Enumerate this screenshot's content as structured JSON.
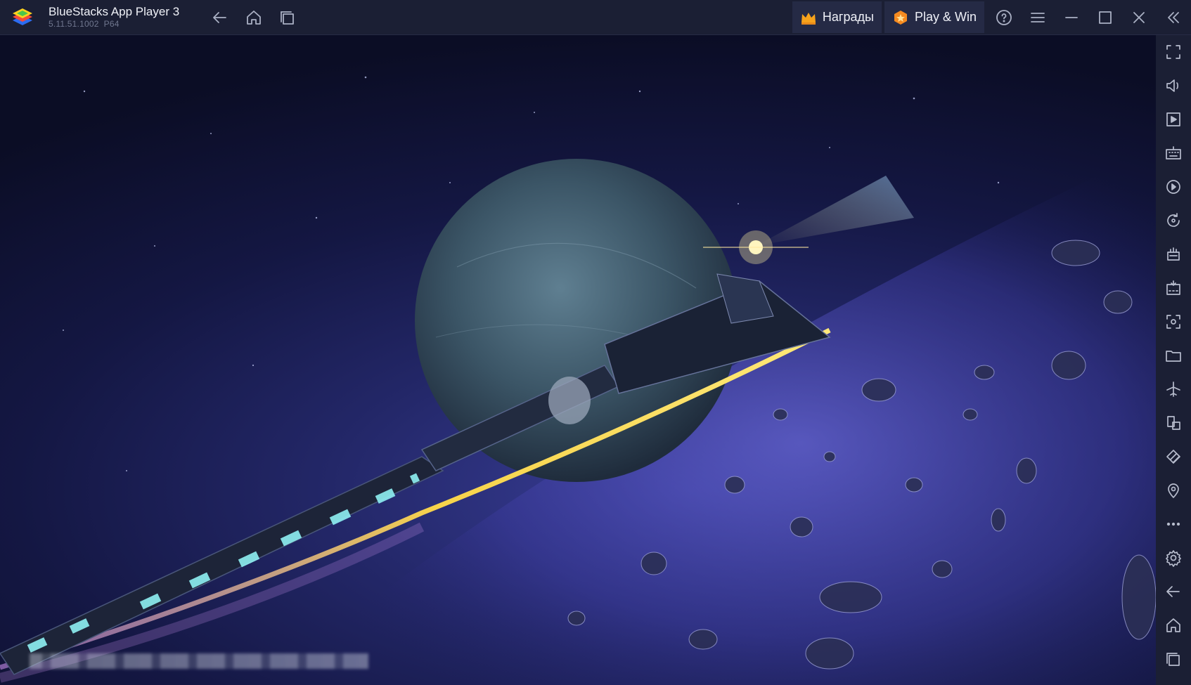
{
  "app": {
    "name": "BlueStacks App Player 3",
    "version": "5.11.51.1002",
    "arch": "P64"
  },
  "titlebar": {
    "rewards_label": "Награды",
    "play_win_label": "Play & Win"
  },
  "colors": {
    "titlebar_bg": "#1b1f34",
    "pill_bg": "#252a45",
    "icon": "#aab0c4",
    "accent_orange": "#f7a21b"
  },
  "sidebar": {
    "icons": [
      "fullscreen-icon",
      "volume-icon",
      "media-icon",
      "keyboard-icon",
      "macro-record-icon",
      "rotate-icon",
      "macro-icon",
      "install-apk-icon",
      "screenshot-icon",
      "folder-icon",
      "airplane-mode-icon",
      "multi-instance-icon",
      "eco-mode-icon",
      "location-icon",
      "more-icon",
      "settings-icon",
      "back-icon",
      "home-icon",
      "recent-apps-icon"
    ]
  }
}
